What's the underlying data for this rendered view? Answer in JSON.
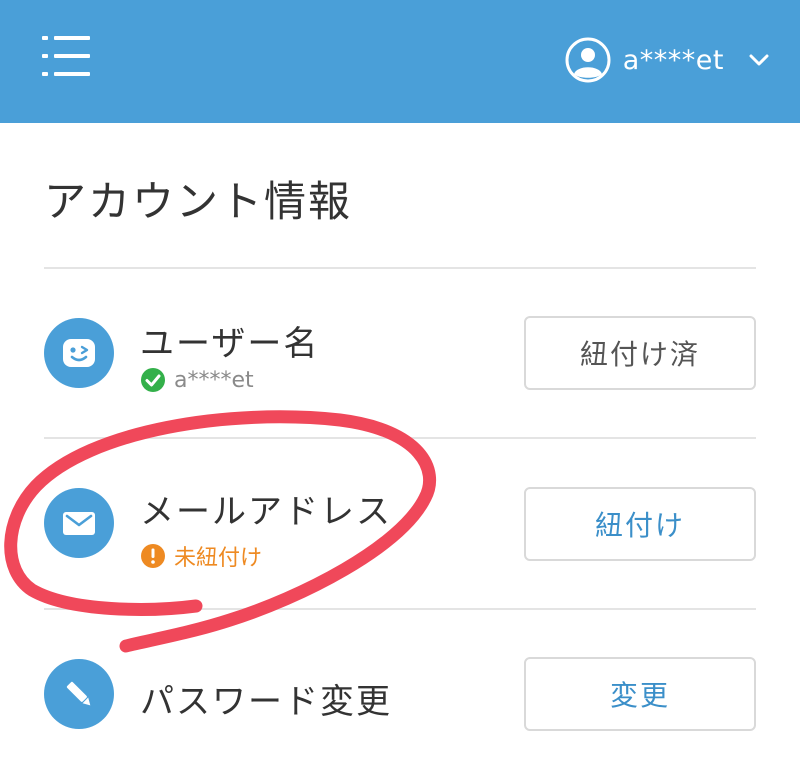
{
  "header": {
    "username": "a****et"
  },
  "page": {
    "title": "アカウント情報"
  },
  "rows": [
    {
      "title": "ユーザー名",
      "status_text": "a****et",
      "status_type": "linked",
      "button_label": "紐付け済"
    },
    {
      "title": "メールアドレス",
      "status_text": "未紐付け",
      "status_type": "unlinked",
      "button_label": "紐付け"
    },
    {
      "title": "パスワード変更",
      "button_label": "変更"
    }
  ],
  "colors": {
    "header_bg": "#4a9fd8",
    "icon_bg": "#4a9fd8",
    "ok_green": "#33b04a",
    "warn_orange": "#ee8a22",
    "link_blue": "#3b8fc9",
    "annotation_red": "#f0485a"
  },
  "icons": {
    "menu": "menu-list-icon",
    "avatar": "user-avatar-icon",
    "chevron": "chevron-down-icon",
    "username_row": "face-wink-icon",
    "email_row": "envelope-icon",
    "password_row": "pencil-icon",
    "ok": "check-circle-icon",
    "warn": "exclamation-circle-icon"
  }
}
